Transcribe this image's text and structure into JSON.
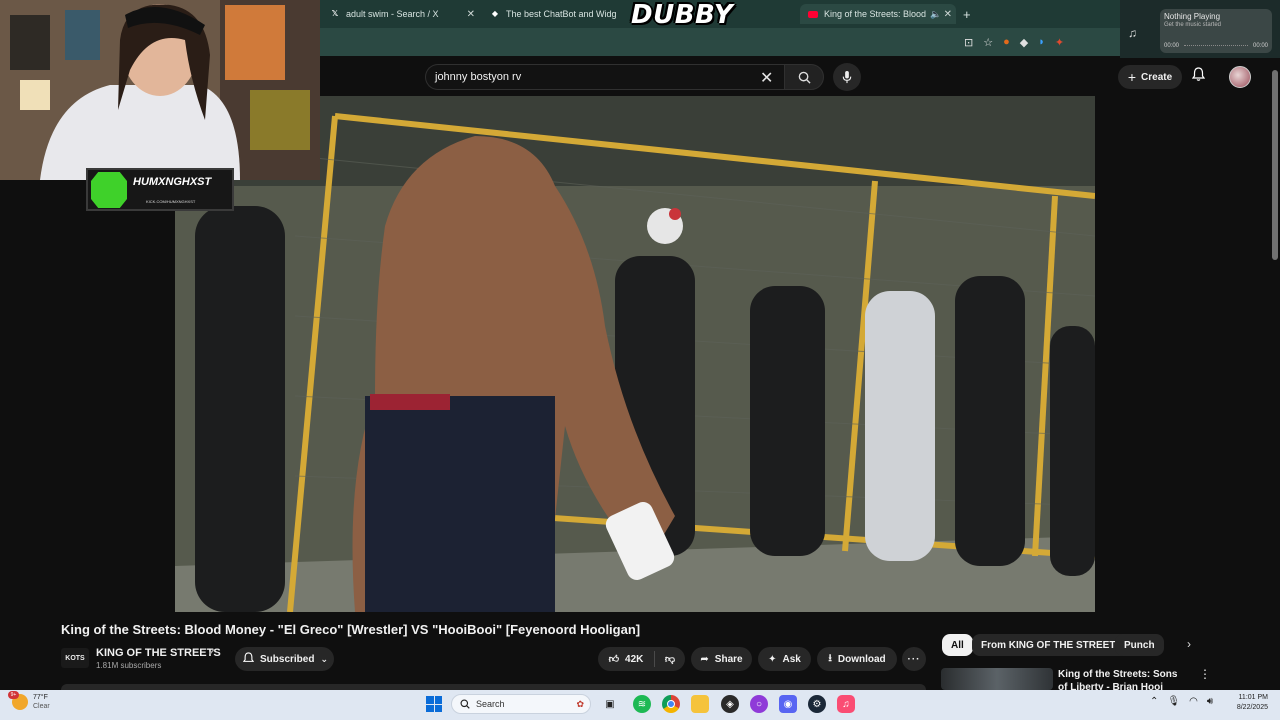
{
  "browser": {
    "tabs": [
      {
        "label": "adult swim - Search / X",
        "icon": "x-logo-icon"
      },
      {
        "label": "The best ChatBot and Widgets",
        "icon": "diamond-icon"
      },
      {
        "label": "King of the Streets: Blood M",
        "icon": "youtube-icon"
      }
    ],
    "media": {
      "title": "Nothing Playing",
      "subtitle": "Get the music started",
      "time_start": "00:00",
      "time_end": "00:00"
    }
  },
  "overlay": {
    "logo": "DUBBY",
    "streamer_name": "HUMXNGHXST",
    "streamer_url": "KICK.COM/HUMXNGHXST"
  },
  "youtube": {
    "search": {
      "value": "johnny bostyon rv"
    },
    "create_label": "Create",
    "video_title": "King of the Streets: Blood Money - \"El Greco\" [Wrestler] VS \"HooiBooi\" [Feyenoord Hooligan]",
    "channel": {
      "avatar_text": "KOTS",
      "name": "KING OF THE STREETS",
      "subscribers": "1.81M subscribers",
      "subscribed_label": "Subscribed"
    },
    "actions": {
      "likes": "42K",
      "share": "Share",
      "ask": "Ask",
      "download": "Download"
    },
    "chips": [
      "All",
      "From KING OF THE STREETS",
      "Punch"
    ],
    "recommendation": {
      "title": "King of the Streets: Sons of Liberty - Brian Hooi [Feyenoor"
    }
  },
  "taskbar": {
    "weather_temp": "77°F",
    "weather_cond": "Clear",
    "weather_badge": "9+",
    "search_label": "Search",
    "time": "11:01 PM",
    "date": "8/22/2025"
  },
  "colors": {
    "tab_bar": "#1f3a35",
    "yt_bg": "#0f0f0f",
    "chip_active": "#f1f1f1",
    "kick_green": "#3fd12a"
  }
}
